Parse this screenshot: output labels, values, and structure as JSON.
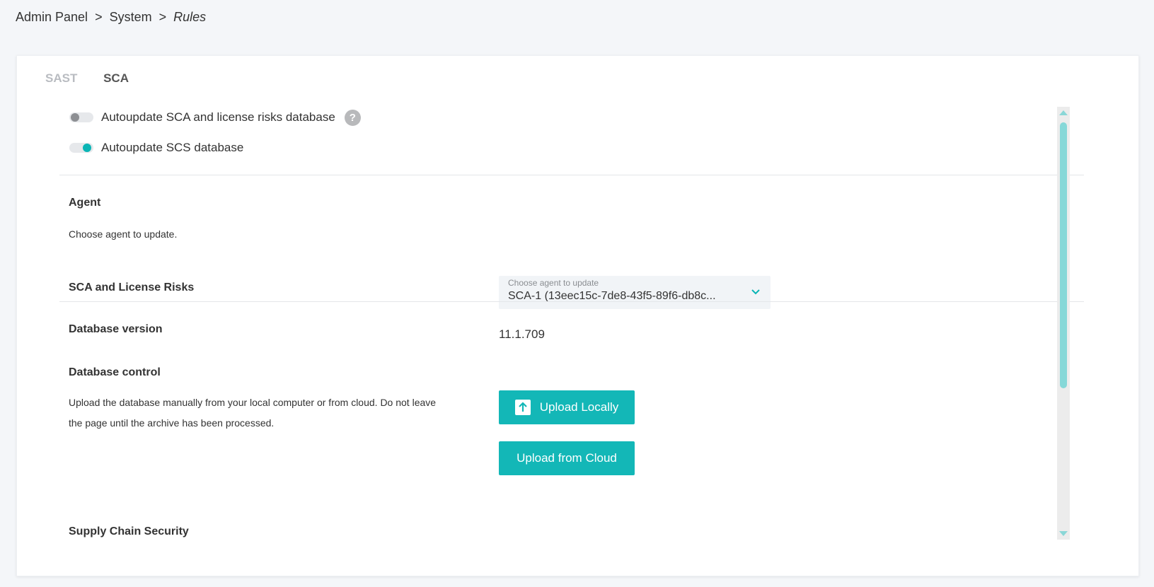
{
  "breadcrumb": {
    "items": [
      "Admin Panel",
      "System"
    ],
    "current": "Rules",
    "separator": ">"
  },
  "tabs": [
    {
      "label": "SAST",
      "active": false
    },
    {
      "label": "SCA",
      "active": true
    }
  ],
  "toggles": {
    "sca_autoupdate": {
      "label": "Autoupdate SCA and license risks database",
      "on": false,
      "help": "?"
    },
    "scs_autoupdate": {
      "label": "Autoupdate SCS database",
      "on": true
    }
  },
  "agent": {
    "title": "Agent",
    "description": "Choose agent to update.",
    "select_label": "Choose agent to update",
    "select_value": "SCA-1 (13eec15c-7de8-43f5-89f6-db8c..."
  },
  "sca": {
    "title": "SCA and License Risks",
    "db_version_label": "Database version",
    "db_version": "11.1.709",
    "db_control_label": "Database control",
    "db_control_desc_line1": "Upload the database manually from your local computer or from cloud. Do not leave",
    "db_control_desc_line2": "the page until the archive has been processed.",
    "upload_local": "Upload Locally",
    "upload_cloud": "Upload from Cloud"
  },
  "scs": {
    "title": "Supply Chain Security"
  },
  "colors": {
    "accent": "#13b7b7",
    "toggle_on": "#0ab5b5",
    "scrollbar_thumb": "#86d8d8"
  },
  "icons": {
    "help": "help-circle-icon",
    "chevron": "chevron-down-icon",
    "upload": "upload-icon"
  }
}
